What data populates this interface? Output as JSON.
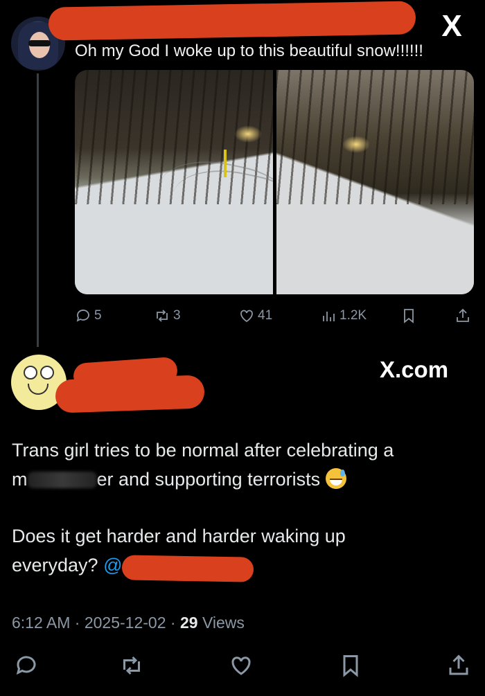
{
  "tweet1": {
    "text": "Oh my God I woke up to this beautiful snow!!!!!!",
    "actions": {
      "replies": "5",
      "reposts": "3",
      "likes": "41",
      "views": "1.2K"
    },
    "images": [
      {
        "alt": "snowy road with trees"
      },
      {
        "alt": "snowy hillside with trees and fence"
      }
    ]
  },
  "header": {
    "close_label": "X"
  },
  "tweet2": {
    "watermark": "X.com",
    "paragraph1_line1": "Trans girl tries to be normal after celebrating a",
    "paragraph1_line2_prefix": "m",
    "paragraph1_line2_suffix": "er and supporting terrorists",
    "paragraph2_line1": "Does it get harder and harder waking up",
    "paragraph2_line2": "everyday?",
    "mention_at": "@",
    "time": "6:12 AM",
    "date": "2025-12-02",
    "separator": "·",
    "views_count": "29",
    "views_label": "Views"
  },
  "colors": {
    "background": "#000000",
    "text": "#e7e9ea",
    "muted": "#8b98a5",
    "link": "#1d9bf0",
    "redaction": "#d9411e"
  },
  "icons": [
    "reply-icon",
    "repost-icon",
    "like-icon",
    "views-icon",
    "bookmark-icon",
    "share-icon",
    "close-icon"
  ]
}
